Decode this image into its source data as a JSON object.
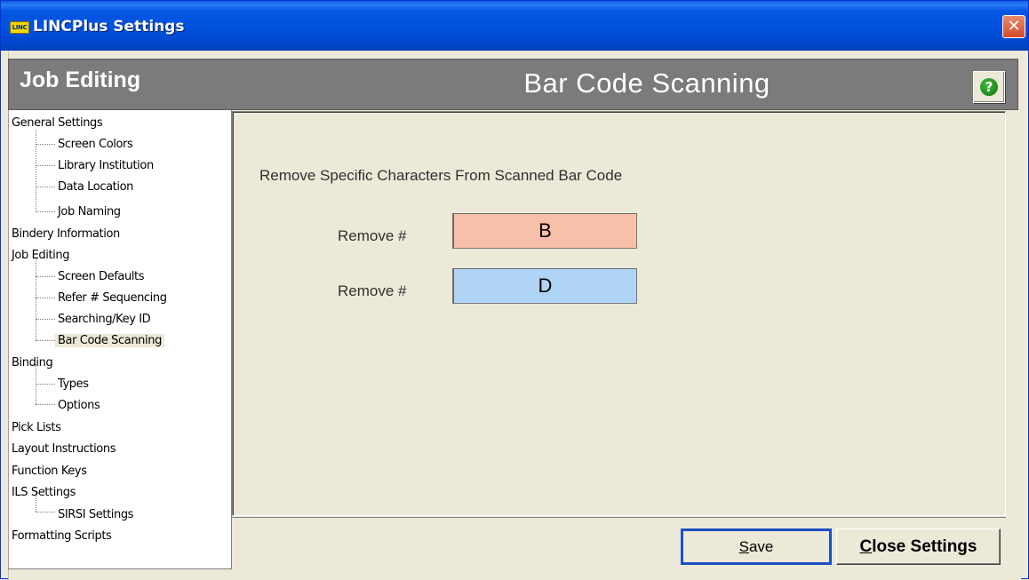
{
  "window": {
    "title": "LINCPlus Settings",
    "app_icon_text": "LINC",
    "close_glyph": "✕"
  },
  "header": {
    "section": "Job Editing",
    "page_title": "Bar Code Scanning",
    "help_glyph": "?"
  },
  "tree": {
    "items": [
      {
        "label": "General Settings",
        "level": 0
      },
      {
        "label": "Screen Colors",
        "level": 1
      },
      {
        "label": "Library Institution",
        "level": 1
      },
      {
        "label": "Data Location",
        "level": 1
      },
      {
        "label": "Job Naming",
        "level": 1
      },
      {
        "label": "Bindery Information",
        "level": 0
      },
      {
        "label": "Job Editing",
        "level": 0
      },
      {
        "label": "Screen Defaults",
        "level": 1
      },
      {
        "label": "Refer # Sequencing",
        "level": 1
      },
      {
        "label": "Searching/Key ID",
        "level": 1
      },
      {
        "label": "Bar Code Scanning",
        "level": 1,
        "selected": true
      },
      {
        "label": "Binding",
        "level": 0
      },
      {
        "label": "Types",
        "level": 1
      },
      {
        "label": "Options",
        "level": 1
      },
      {
        "label": "Pick Lists",
        "level": 0
      },
      {
        "label": "Layout Instructions",
        "level": 0
      },
      {
        "label": "Function Keys",
        "level": 0
      },
      {
        "label": "ILS Settings",
        "level": 0
      },
      {
        "label": "SIRSI Settings",
        "level": 1
      },
      {
        "label": "Formatting Scripts",
        "level": 0
      }
    ]
  },
  "content": {
    "instruction": "Remove Specific Characters From Scanned Bar Code",
    "fields": [
      {
        "label": "Remove #",
        "value": "B",
        "color": "#f8c0a8"
      },
      {
        "label": "Remove #",
        "value": "D",
        "color": "#b0d4f6"
      }
    ]
  },
  "buttons": {
    "save_prefix": "S",
    "save_rest": "ave",
    "close_prefix": "C",
    "close_rest": "lose Settings"
  }
}
